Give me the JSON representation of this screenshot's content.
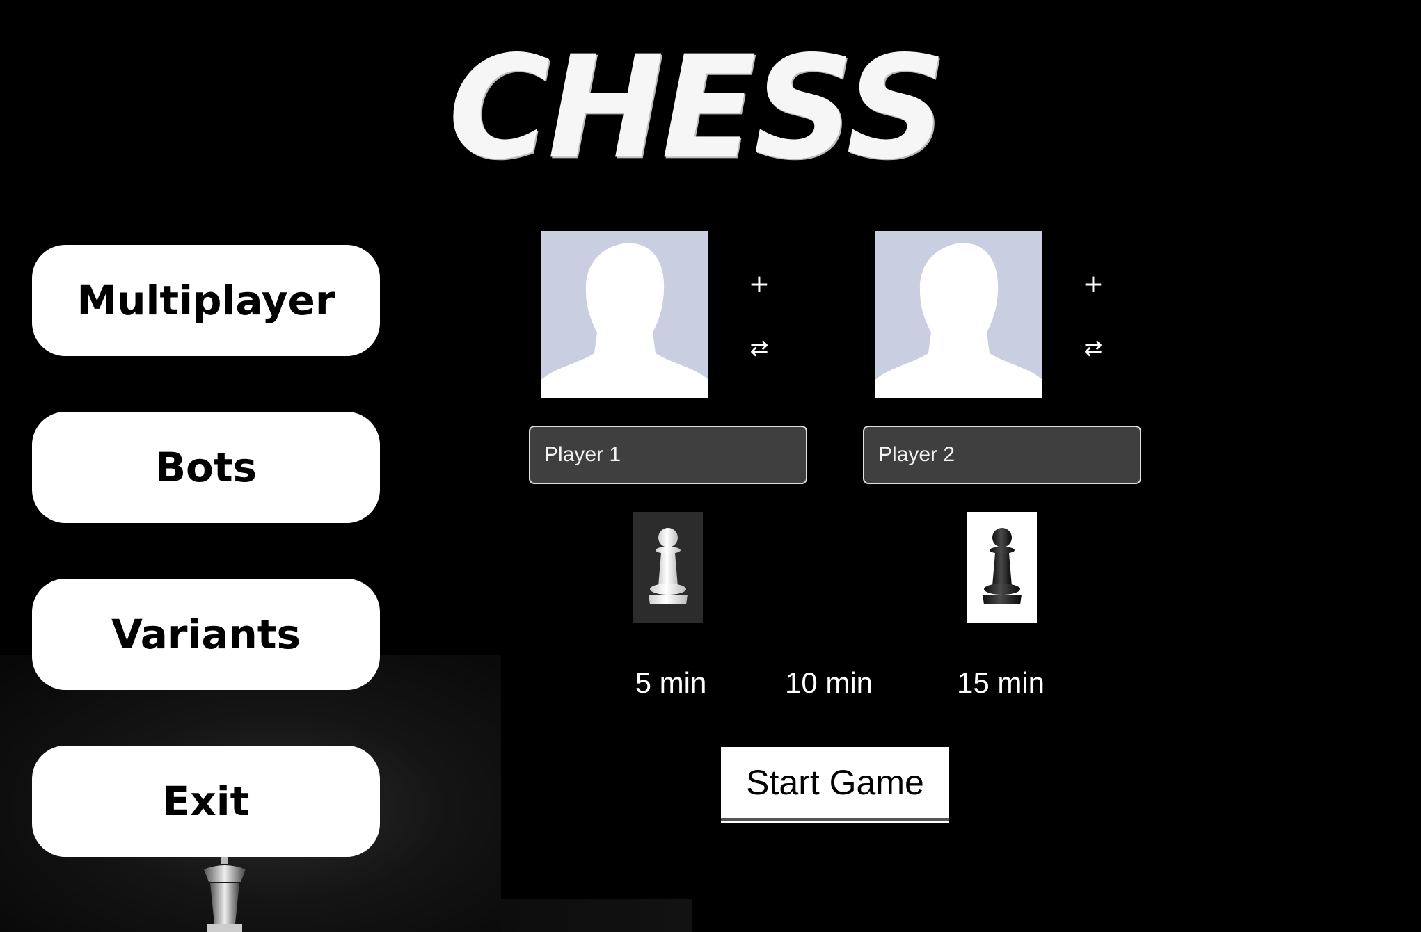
{
  "title": "CHESS",
  "menu": {
    "multiplayer": "Multiplayer",
    "bots": "Bots",
    "variants": "Variants",
    "exit": "Exit"
  },
  "players": [
    {
      "avatar_icon": "person-silhouette-icon",
      "add_icon": "+",
      "swap_icon": "⇄",
      "name_value": "Player 1",
      "piece_color": "white"
    },
    {
      "avatar_icon": "person-silhouette-icon",
      "add_icon": "+",
      "swap_icon": "⇄",
      "name_value": "Player 2",
      "piece_color": "black"
    }
  ],
  "time_options": [
    "5 min",
    "10 min",
    "15 min"
  ],
  "start_label": "Start Game",
  "colors": {
    "background": "#000000",
    "button_bg": "#ffffff",
    "avatar_bg": "#c9cfe0",
    "input_bg": "#3f3f3f"
  }
}
